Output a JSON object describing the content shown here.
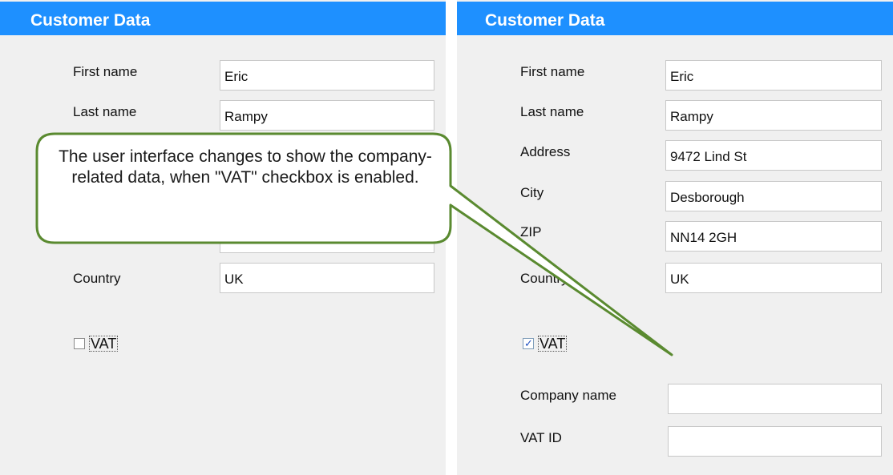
{
  "left_panel": {
    "title": "Customer Data",
    "fields": {
      "first_name": {
        "label": "First name",
        "value": "Eric"
      },
      "last_name": {
        "label": "Last name",
        "value": "Rampy"
      },
      "country": {
        "label": "Country",
        "value": "UK"
      }
    },
    "vat": {
      "label": "VAT",
      "checked": false
    }
  },
  "right_panel": {
    "title": "Customer Data",
    "fields": {
      "first_name": {
        "label": "First name",
        "value": "Eric"
      },
      "last_name": {
        "label": "Last name",
        "value": "Rampy"
      },
      "address": {
        "label": "Address",
        "value": "9472 Lind St"
      },
      "city": {
        "label": "City",
        "value": "Desborough"
      },
      "zip": {
        "label": "ZIP",
        "value": "NN14 2GH"
      },
      "country": {
        "label": "Country",
        "value": "UK"
      },
      "company_name": {
        "label": "Company name",
        "value": ""
      },
      "vat_id": {
        "label": "VAT ID",
        "value": ""
      }
    },
    "vat": {
      "label": "VAT",
      "checked": true,
      "check_glyph": "✓"
    }
  },
  "callout": {
    "text": "The user interface changes to show the company-related data, when \"VAT\" checkbox is enabled.",
    "border_color": "#5a8a30"
  },
  "colors": {
    "header_bg": "#1e90ff",
    "panel_bg": "#f0f0f0"
  }
}
